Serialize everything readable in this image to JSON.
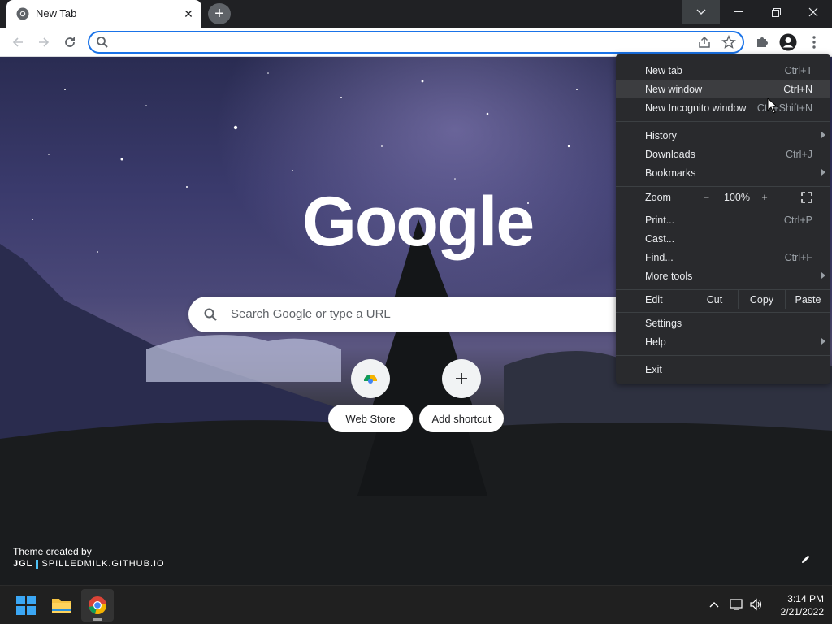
{
  "window": {
    "tab_title": "New Tab",
    "tab_icon": "chrome-icon",
    "close_tab_icon": "close-icon",
    "new_tab_icon": "plus-icon"
  },
  "toolbar": {
    "omnibox_value": "",
    "omnibox_placeholder": ""
  },
  "ntp": {
    "logo": "Google",
    "search_placeholder": "Search Google or type a URL",
    "shortcuts": [
      {
        "label": "Web Store",
        "icon": "web-store-icon"
      },
      {
        "label": "Add shortcut",
        "icon": "plus-icon"
      }
    ],
    "theme_label": "Theme created by",
    "theme_author_short": "JGL",
    "theme_author_site": "SPILLEDMILK.GITHUB.IO"
  },
  "menu": {
    "new_tab": {
      "label": "New tab",
      "shortcut": "Ctrl+T"
    },
    "new_window": {
      "label": "New window",
      "shortcut": "Ctrl+N"
    },
    "new_incognito": {
      "label": "New Incognito window",
      "shortcut": "Ctrl+Shift+N"
    },
    "history": {
      "label": "History"
    },
    "downloads": {
      "label": "Downloads",
      "shortcut": "Ctrl+J"
    },
    "bookmarks": {
      "label": "Bookmarks"
    },
    "zoom": {
      "label": "Zoom",
      "minus": "−",
      "value": "100%",
      "plus": "+"
    },
    "print": {
      "label": "Print...",
      "shortcut": "Ctrl+P"
    },
    "cast": {
      "label": "Cast..."
    },
    "find": {
      "label": "Find...",
      "shortcut": "Ctrl+F"
    },
    "more_tools": {
      "label": "More tools"
    },
    "edit": {
      "label": "Edit",
      "cut": "Cut",
      "copy": "Copy",
      "paste": "Paste"
    },
    "settings": {
      "label": "Settings"
    },
    "help": {
      "label": "Help"
    },
    "exit": {
      "label": "Exit"
    }
  },
  "taskbar": {
    "time": "3:14 PM",
    "date": "2/21/2022"
  },
  "colors": {
    "accent": "#1a73e8",
    "menu_bg": "#292a2d",
    "titlebar_bg": "#202124",
    "taskbar_bg": "#202020"
  }
}
